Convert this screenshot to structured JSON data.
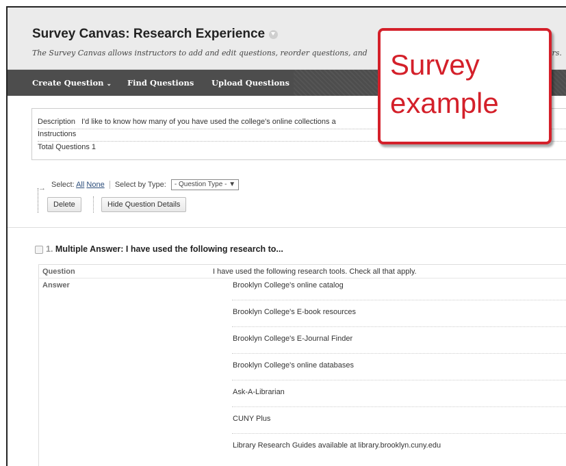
{
  "header": {
    "title": "Survey Canvas: Research Experience",
    "subtitle": "The Survey Canvas allows instructors to add and edit questions, reorder questions, and",
    "subtitle_end": "ers."
  },
  "toolbar": {
    "create_question": "Create Question",
    "find_questions": "Find Questions",
    "upload_questions": "Upload Questions"
  },
  "details": {
    "description_label": "Description",
    "description_value": "I'd like to know how many of you have used the college's online collections a",
    "instructions_label": "Instructions",
    "total_questions_label": "Total Questions",
    "total_questions_value": "1"
  },
  "selection": {
    "select_label": "Select:",
    "all_link": "All",
    "none_link": "None",
    "select_by_type_label": "Select by Type:",
    "type_select_value": "- Question Type -"
  },
  "buttons": {
    "delete": "Delete",
    "hide_details": "Hide Question Details"
  },
  "question": {
    "number": "1.",
    "title": "Multiple Answer: I have used the following research to...",
    "question_label": "Question",
    "question_text": "I have used the following research tools.  Check all that apply.",
    "answer_label": "Answer",
    "answers": [
      "Brooklyn College's online catalog",
      "Brooklyn College's E-book resources",
      "Brooklyn College's E-Journal Finder",
      "Brooklyn College's online databases",
      "Ask-A-Librarian",
      "CUNY Plus",
      "Library Research Guides available at library.brooklyn.cuny.edu"
    ]
  },
  "callout": {
    "line1": "Survey",
    "line2": "example"
  },
  "colors": {
    "action_bar": "#4d4d4d",
    "callout_red": "#d4202a"
  }
}
